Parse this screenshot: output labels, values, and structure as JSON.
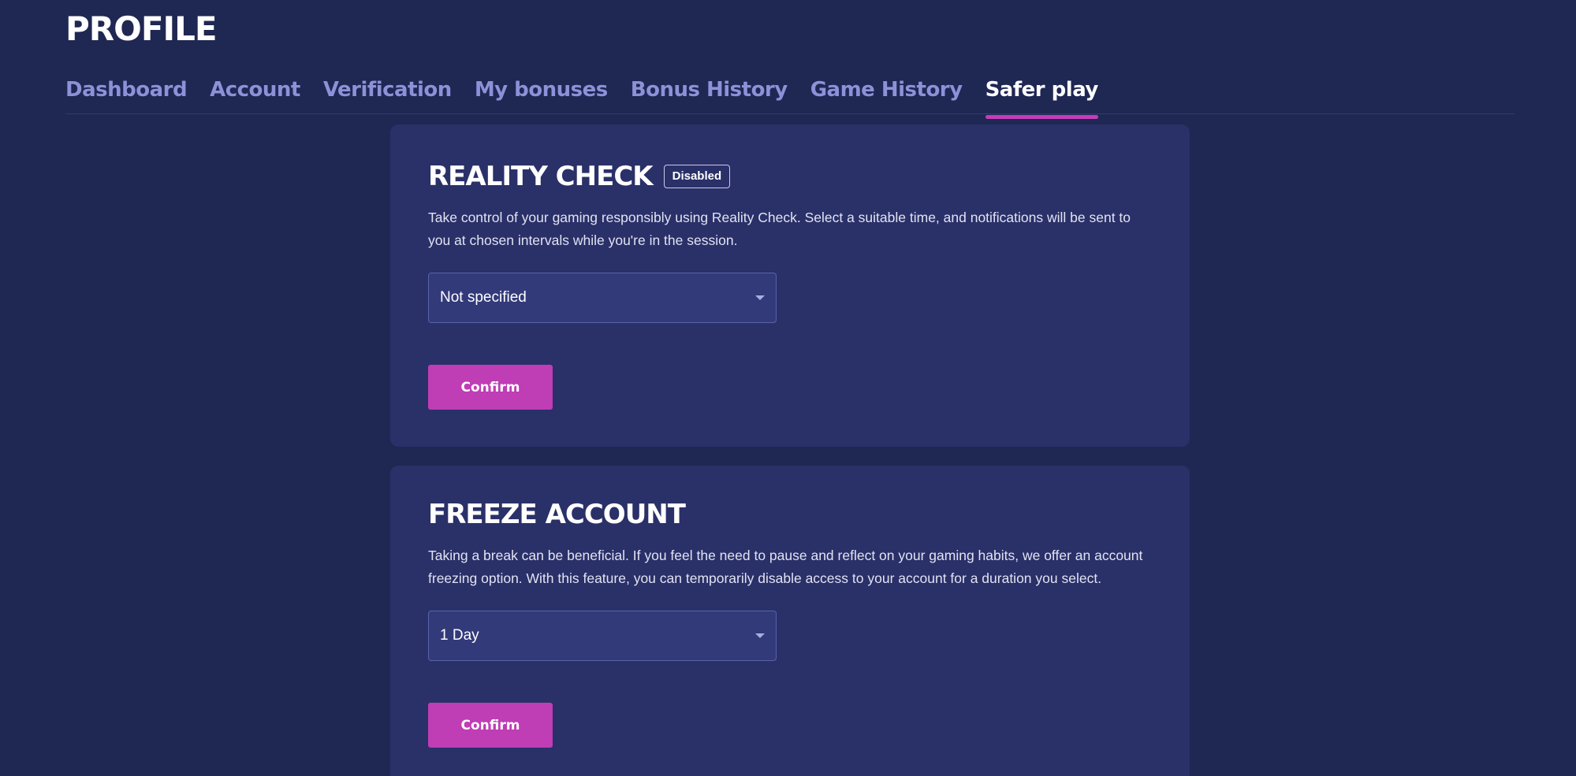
{
  "header": {
    "title": "PROFILE"
  },
  "tabs": [
    {
      "label": "Dashboard",
      "active": false
    },
    {
      "label": "Account",
      "active": false
    },
    {
      "label": "Verification",
      "active": false
    },
    {
      "label": "My bonuses",
      "active": false
    },
    {
      "label": "Bonus History",
      "active": false
    },
    {
      "label": "Game History",
      "active": false
    },
    {
      "label": "Safer play",
      "active": true
    }
  ],
  "reality_check": {
    "title": "REALITY CHECK",
    "badge": "Disabled",
    "description": "Take control of your gaming responsibly using Reality Check. Select a suitable time, and notifications will be sent to you at chosen intervals while you're in the session.",
    "select_value": "Not specified",
    "confirm_label": "Confirm"
  },
  "freeze_account": {
    "title": "FREEZE ACCOUNT",
    "description": "Taking a break can be beneficial. If you feel the need to pause and reflect on your gaming habits, we offer an account freezing option. With this feature, you can temporarily disable access to your account for a duration you select.",
    "select_value": "1 Day",
    "confirm_label": "Confirm"
  },
  "colors": {
    "background": "#1f2753",
    "card": "#2a3068",
    "accent": "#bf3db5",
    "tab_inactive": "#8c92d8"
  },
  "icons": {
    "select_chevron": "chevron-down-icon"
  }
}
